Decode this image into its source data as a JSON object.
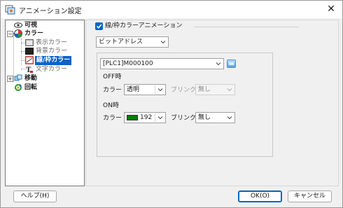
{
  "window": {
    "title": "アニメーション設定"
  },
  "tree": {
    "items": [
      {
        "label": "可視",
        "icon": "eye-icon"
      },
      {
        "label": "カラー",
        "icon": "palette-icon"
      },
      {
        "label": "表示カラー",
        "icon": "display-color-icon"
      },
      {
        "label": "背景カラー",
        "icon": "background-color-icon"
      },
      {
        "label": "線/枠カラー",
        "icon": "line-frame-color-icon"
      },
      {
        "label": "文字カラー",
        "icon": "text-color-icon"
      },
      {
        "label": "移動",
        "icon": "move-icon"
      },
      {
        "label": "回転",
        "icon": "rotate-icon"
      }
    ]
  },
  "panel": {
    "enable_label": "線/枠カラーアニメーション",
    "enabled": true,
    "mode_value": "ビットアドレス",
    "address_value": "[PLC1]M000100",
    "off": {
      "heading": "OFF時",
      "color_label": "カラー",
      "color_value": "透明",
      "blink_label": "ブリンク",
      "blink_value": "無し"
    },
    "on": {
      "heading": "ON時",
      "color_label": "カラー",
      "color_value": "192",
      "color_swatch": "#008000",
      "blink_label": "ブリンク",
      "blink_value": "無し"
    }
  },
  "buttons": {
    "help": "ヘルプ(H)",
    "ok": "OK(O)",
    "cancel": "キャンセル"
  },
  "colors": {
    "accent": "#0067c0",
    "selection": "#0a64c8"
  }
}
